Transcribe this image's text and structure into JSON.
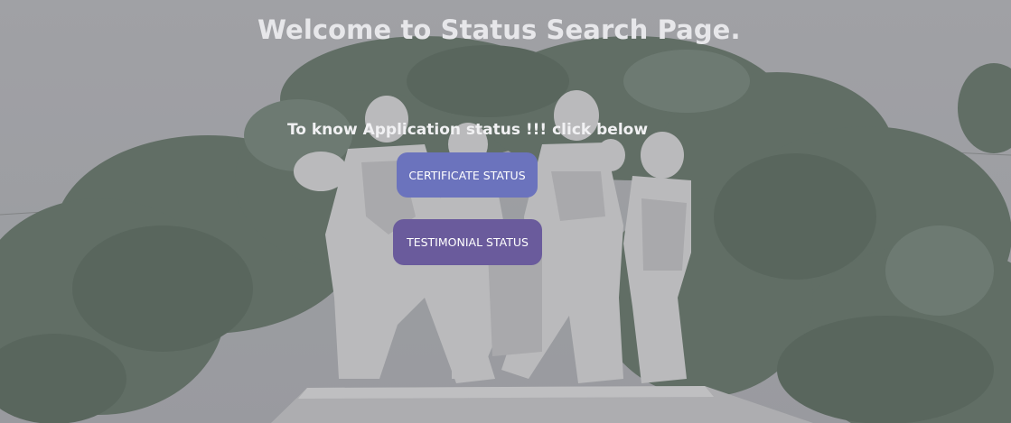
{
  "page": {
    "title": "Welcome to Status Search Page.",
    "subtitle": "To know Application status !!! click below"
  },
  "buttons": {
    "certificate_label": "CERTIFICATE STATUS",
    "testimonial_label": "TESTIMONIAL STATUS"
  },
  "colors": {
    "certificate_button": "#6b73bd",
    "testimonial_button": "#6a5b9c",
    "title_text": "#e7e7ea"
  }
}
